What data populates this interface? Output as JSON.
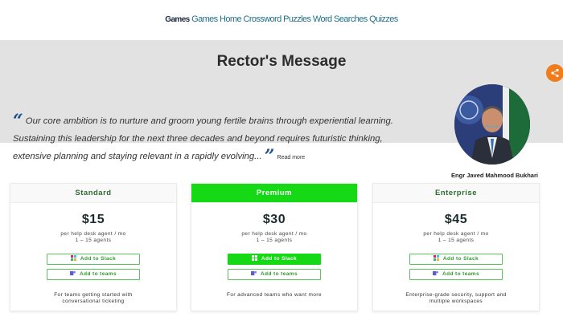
{
  "nav": {
    "brand": "Games",
    "links": [
      "Games",
      "Home",
      "Crossword Puzzles",
      "Word Searches",
      "Quizzes"
    ]
  },
  "hero": {
    "title": "Rector's Message",
    "quote": "Our core ambition is to nurture and groom young fertile brains through experiential learning. Sustaining this leadership for the next three decades and beyond requires futuristic thinking, extensive planning and staying relevant in a rapidly evolving...",
    "read_more": "Read more",
    "person_name": "Engr Javed Mahmood Bukhari"
  },
  "plans": [
    {
      "name": "Standard",
      "price": "$15",
      "per": "per help desk agent / mo",
      "agents": "1 – 15 agents",
      "slack_label": "Add to Slack",
      "teams_label": "Add to teams",
      "description": "For teams getting started with conversational ticketing"
    },
    {
      "name": "Premium",
      "price": "$30",
      "per": "per help desk agent / mo",
      "agents": "1 – 15 agents",
      "slack_label": "Add to Slack",
      "teams_label": "Add to teams",
      "description": "For advanced teams who want more"
    },
    {
      "name": "Enterprise",
      "price": "$45",
      "per": "per help desk agent / mo",
      "agents": "1 – 15 agents",
      "slack_label": "Add to Slack",
      "teams_label": "Add to teams",
      "description": "Enterprise-grade security, support and multiple workspaces"
    }
  ],
  "colors": {
    "accent_green": "#16d916",
    "share_orange": "#f07c1b",
    "quote_blue": "#1f4f8f",
    "hero_gray": "#e2e2e2"
  },
  "icons": {
    "share": "share-icon",
    "slack": "slack-icon",
    "teams": "teams-icon",
    "quote": "quote-icon"
  }
}
